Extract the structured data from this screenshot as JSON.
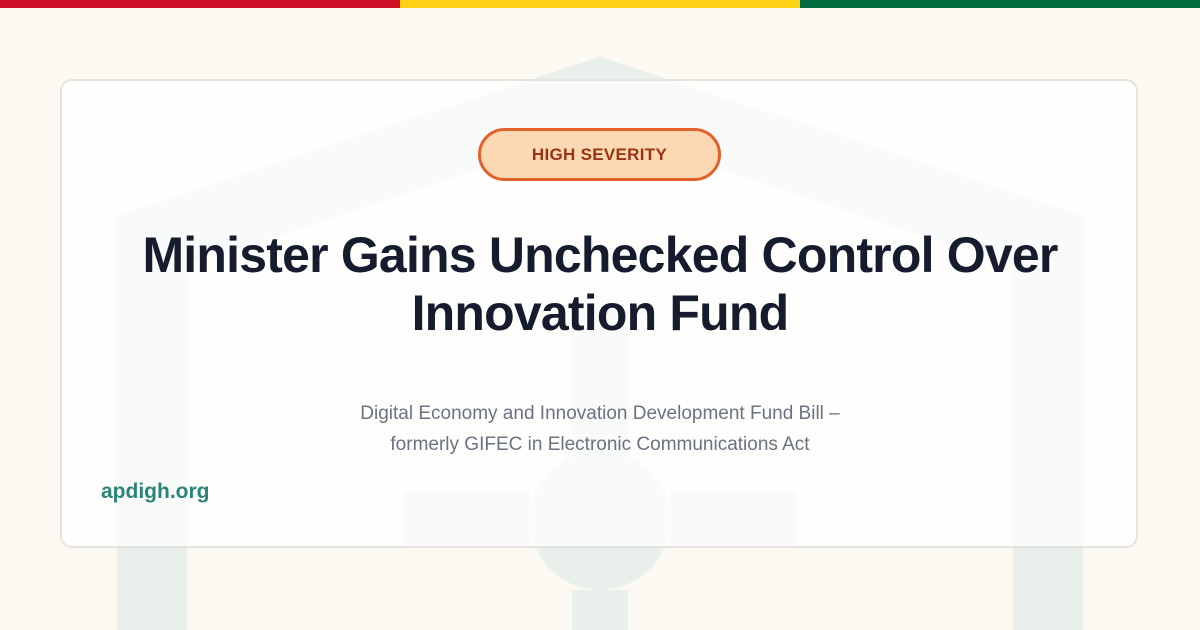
{
  "colors": {
    "flag_red": "#ce1126",
    "flag_gold": "#fcd116",
    "flag_green": "#006b3f",
    "watermark": "#e9f0ec",
    "badge_border": "#e3622a",
    "badge_fill": "#fdd9b3",
    "badge_text": "#9a3412",
    "title_text": "#141c2e",
    "subtitle_text": "#6b7282",
    "domain_text": "#2b8478"
  },
  "badge": {
    "label": "HIGH SEVERITY"
  },
  "headline": {
    "line1": "Minister Gains Unchecked Control Over",
    "line2": "Innovation Fund"
  },
  "subheadline": {
    "line1": "Digital Economy and Innovation Development Fund Bill –",
    "line2": "formerly GIFEC in Electronic Communications Act"
  },
  "site": {
    "domain": "apdigh.org"
  },
  "watermark": {
    "icon": "house-keyhole-icon"
  }
}
